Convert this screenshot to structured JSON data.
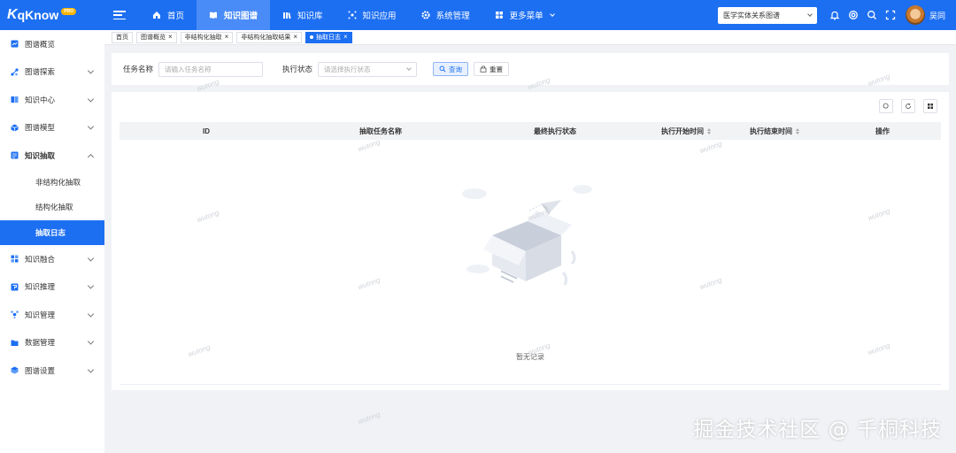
{
  "app": {
    "logo_k": "K",
    "logo_name": "qKnow",
    "logo_badge": "PRO"
  },
  "nav": [
    {
      "label": "首页",
      "icon": "home-icon"
    },
    {
      "label": "知识图谱",
      "icon": "book-icon",
      "active": true
    },
    {
      "label": "知识库",
      "icon": "library-icon"
    },
    {
      "label": "知识应用",
      "icon": "sparkle-icon"
    },
    {
      "label": "系统管理",
      "icon": "gear-icon"
    },
    {
      "label": "更多菜单",
      "icon": "grid-icon"
    }
  ],
  "header": {
    "graph_select": "医学实体关系图谱",
    "username": "吴同"
  },
  "sidebar": [
    {
      "label": "图谱概览"
    },
    {
      "label": "图谱探索"
    },
    {
      "label": "知识中心"
    },
    {
      "label": "图谱模型"
    },
    {
      "label": "知识抽取"
    },
    {
      "label": "非结构化抽取"
    },
    {
      "label": "结构化抽取"
    },
    {
      "label": "抽取日志"
    },
    {
      "label": "知识融合"
    },
    {
      "label": "知识推理"
    },
    {
      "label": "知识管理"
    },
    {
      "label": "数据管理"
    },
    {
      "label": "图谱设置"
    }
  ],
  "tabs": [
    {
      "label": "首页"
    },
    {
      "label": "图谱概览"
    },
    {
      "label": "非结构化抽取"
    },
    {
      "label": "非结构化抽取结果"
    },
    {
      "label": "抽取日志"
    }
  ],
  "search": {
    "task_name_label": "任务名称",
    "task_name_placeholder": "请输入任务名称",
    "status_label": "执行状态",
    "status_placeholder": "请选择执行状态",
    "query_button": "查询",
    "reset_button": "重置"
  },
  "table": {
    "columns": [
      "ID",
      "抽取任务名称",
      "最终执行状态",
      "执行开始时间",
      "执行结束时间",
      "操作"
    ],
    "empty_text": "暂无记录"
  },
  "watermark": "wutong",
  "corner_mark": "掘金技术社区 @ 千桐科技",
  "colors": {
    "primary": "#1d6ff2",
    "active_nav": "#4a8cf7",
    "page_bg": "#f0f2f5"
  }
}
